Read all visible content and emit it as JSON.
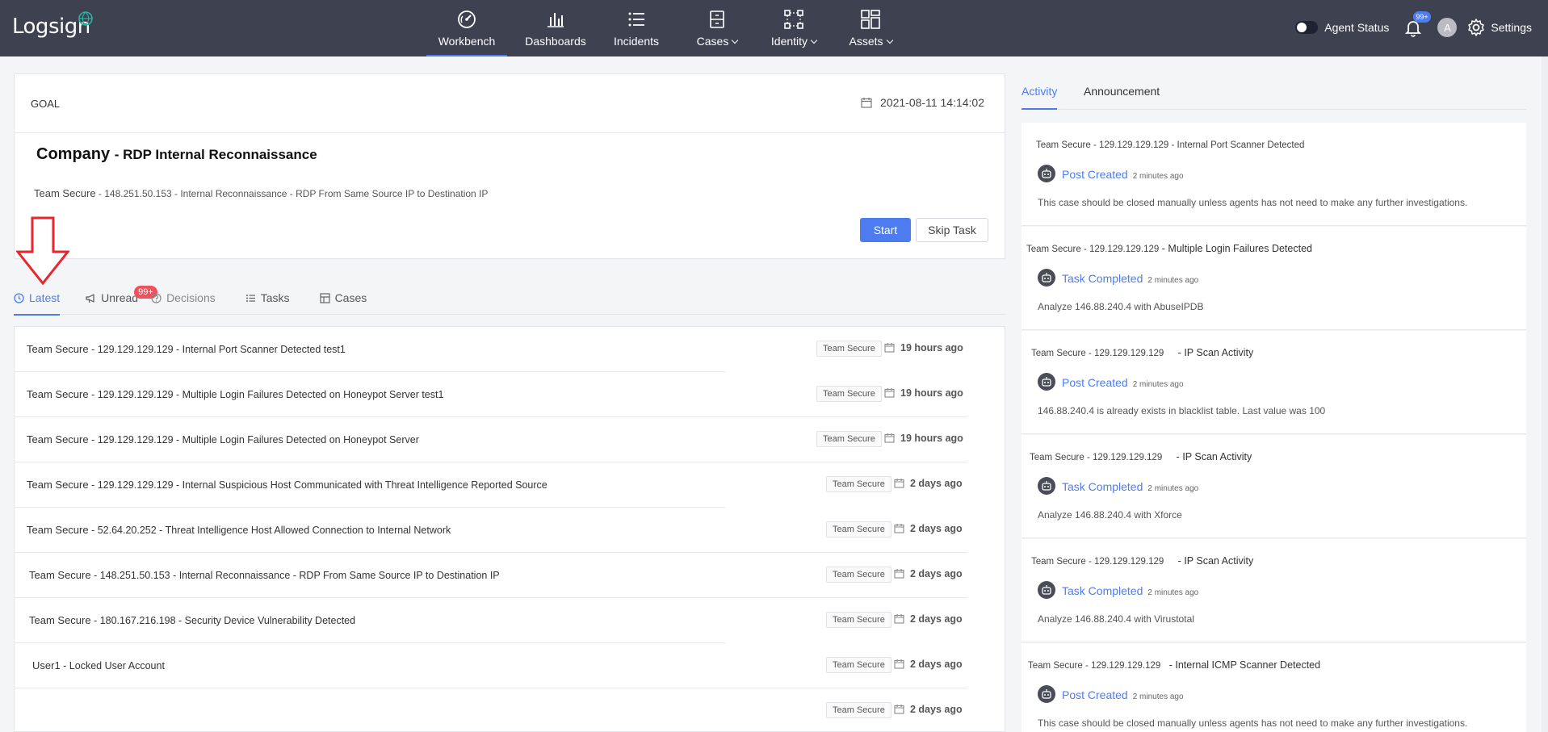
{
  "header": {
    "logo": "Logsign",
    "nav": [
      {
        "label": "Workbench",
        "icon": "gauge-icon",
        "active": true,
        "caret": false
      },
      {
        "label": "Dashboards",
        "icon": "bar-chart-icon",
        "active": false,
        "caret": false
      },
      {
        "label": "Incidents",
        "icon": "list-icon",
        "active": false,
        "caret": false
      },
      {
        "label": "Cases",
        "icon": "cabinet-icon",
        "active": false,
        "caret": true
      },
      {
        "label": "Identity",
        "icon": "identity-nodes-icon",
        "active": false,
        "caret": true
      },
      {
        "label": "Assets",
        "icon": "assets-grid-icon",
        "active": false,
        "caret": true
      }
    ],
    "agent_status_label": "Agent Status",
    "notification_badge": "99+",
    "avatar_letter": "A",
    "settings_label": "Settings"
  },
  "goal": {
    "label": "GOAL",
    "date": "2021-08-11 14:14:02",
    "title_main": "Company",
    "title_sub": "- RDP Internal Reconnaissance",
    "desc_team": "Team Secure",
    "desc_rest": " - 148.251.50.153 - Internal Reconnaissance - RDP From Same Source IP to Destination IP",
    "start_label": "Start",
    "skip_label": "Skip Task"
  },
  "tabs": {
    "latest": "Latest",
    "unread": "Unread",
    "unread_badge": "99+",
    "decisions": "Decisions",
    "tasks": "Tasks",
    "cases": "Cases"
  },
  "list": [
    {
      "pre": "Team Secure",
      "text": " - 129.129.129.129 - Internal Port Scanner Detected test1",
      "tag": "Team Secure",
      "time": "19 hours ago"
    },
    {
      "pre": "Team Secure",
      "text": " - 129.129.129.129 - Multiple Login Failures Detected on Honeypot Server test1",
      "tag": "Team Secure",
      "time": "19 hours ago"
    },
    {
      "pre": "Team Secure",
      "text": " - 129.129.129.129 - Multiple Login Failures Detected on Honeypot Server",
      "tag": "Team Secure",
      "time": "19 hours ago"
    },
    {
      "pre": "Team Secure",
      "text": " - 129.129.129.129 - Internal Suspicious Host Communicated with Threat Intelligence Reported Source",
      "tag": "Team Secure",
      "time": "2 days ago"
    },
    {
      "pre": "Team Secure",
      "text": " - 52.64.20.252 - Threat Intelligence Host Allowed Connection to Internal Network",
      "tag": "Team Secure",
      "time": "2 days ago"
    },
    {
      "pre": "Team Secure",
      "text": " - 148.251.50.153 - Internal Reconnaissance - RDP From Same Source IP to Destination IP",
      "tag": "Team Secure",
      "time": "2 days ago"
    },
    {
      "pre": "Team Secure",
      "text": " - 180.167.216.198 - Security Device Vulnerability Detected",
      "tag": "Team Secure",
      "time": "2 days ago"
    },
    {
      "pre": "User1",
      "text": " - Locked User Account",
      "tag": "Team Secure",
      "time": "2 days ago"
    },
    {
      "pre": "",
      "text": "",
      "tag": "Team Secure",
      "time": "2 days ago"
    }
  ],
  "right_tabs": {
    "activity": "Activity",
    "announcement": "Announcement"
  },
  "activity": [
    {
      "title": "Team Secure - 129.129.129.129 - Internal Port Scanner Detected",
      "suffix": "",
      "action": "Post Created",
      "ago": "2 minutes ago",
      "body": "This case should be closed manually unless agents has not need to make any further investigations."
    },
    {
      "title": "Team Secure - 129.129.129.129",
      "suffix": " - Multiple Login Failures Detected",
      "action": "Task Completed",
      "ago": "2 minutes ago",
      "body": "Analyze 146.88.240.4 with AbuseIPDB"
    },
    {
      "title": "Team Secure - 129.129.129.129",
      "suffix": "     - IP Scan Activity",
      "action": "Post Created",
      "ago": "2 minutes ago",
      "body": "146.88.240.4 is already exists in blacklist table. Last value was 100"
    },
    {
      "title": "Team Secure - 129.129.129.129",
      "suffix": "     - IP Scan Activity",
      "action": "Task Completed",
      "ago": "2 minutes ago",
      "body": "Analyze 146.88.240.4 with Xforce"
    },
    {
      "title": "Team Secure - 129.129.129.129",
      "suffix": "     - IP Scan Activity",
      "action": "Task Completed",
      "ago": "2 minutes ago",
      "body": "Analyze 146.88.240.4 with Virustotal"
    },
    {
      "title": "Team Secure - 129.129.129.129",
      "suffix": "   - Internal ICMP Scanner Detected",
      "action": "Post Created",
      "ago": "2 minutes ago",
      "body": "This case should be closed manually unless agents has not need to make any further investigations."
    }
  ],
  "colors": {
    "topbar": "#3d4150",
    "accent": "#4d7cf0",
    "badge_red": "#f2505b",
    "arrow_red": "#e8262d"
  }
}
